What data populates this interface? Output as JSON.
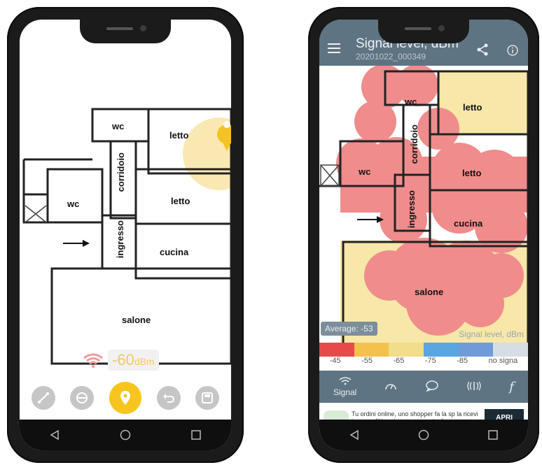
{
  "left_phone": {
    "rooms": [
      "wc",
      "letto",
      "corridoio",
      "wc",
      "letto",
      "ingresso",
      "cucina",
      "salone"
    ],
    "signal_value": "-60",
    "signal_unit": "dBm",
    "controls": [
      "measure-tool-icon",
      "ruler-icon",
      "location-pin-icon",
      "undo-icon",
      "save-icon"
    ]
  },
  "right_phone": {
    "title": "Signal level, dBm",
    "subtitle": "20201022_000349",
    "rooms": [
      "wc",
      "letto",
      "corridoio",
      "wc",
      "letto",
      "ingresso",
      "cucina",
      "salone"
    ],
    "average": "Average: -53",
    "legend_title": "Signal level, dBm",
    "scale_colors": [
      "#e84a4a",
      "#f4c24a",
      "#f2dd8a",
      "#5aa6e0",
      "#6f9bd8",
      "#d6dde3"
    ],
    "scale_ticks": [
      "-45",
      "-55",
      "-65",
      "-75",
      "-85",
      "no signa"
    ],
    "tabs": [
      {
        "icon": "wifi-icon",
        "label": "Signal"
      },
      {
        "icon": "speedometer-icon",
        "label": ""
      },
      {
        "icon": "chat-icon",
        "label": ""
      },
      {
        "icon": "waves-icon",
        "label": ""
      },
      {
        "icon": "function-icon",
        "label": "f"
      }
    ],
    "ad": {
      "text": "Tu ordini online, uno shopper fa la sp la ricevi in comodità e sicurezza a ca tua!",
      "button": "APRI"
    }
  },
  "colors": {
    "heat_red": "#f08c8c",
    "heat_yellow": "#f7e7a8",
    "accent_yellow": "#f7c51e",
    "topbar": "#5f7482"
  }
}
